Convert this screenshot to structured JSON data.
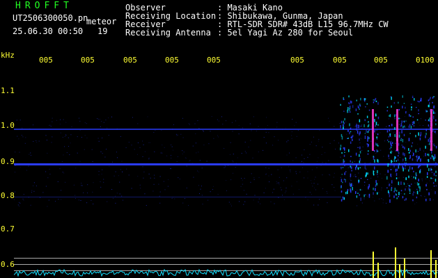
{
  "app": {
    "title": "HROFFT"
  },
  "file": {
    "name": "UT2506300050.pn",
    "meteor_label": "meteor",
    "datetime": "25.06.30 00:50",
    "meteor_count": "19"
  },
  "header": {
    "rows": [
      {
        "key": "Observer",
        "value": ": Masaki Kano"
      },
      {
        "key": "Receiving Location",
        "value": ": Shibukawa, Gunma, Japan"
      },
      {
        "key": "Receiver",
        "value": ": RTL-SDR SDR# 43dB L15 96.7MHz CW"
      },
      {
        "key": "Receiving Antenna",
        "value": ": 5el Yagi Az 280 for Seoul"
      }
    ]
  },
  "axis": {
    "unit_label": "kHz",
    "time_labels": [
      "005",
      "005",
      "005",
      "005",
      "005",
      "005",
      "005",
      "005",
      "0100"
    ],
    "freq_labels": [
      "1.1",
      "1.0",
      "0.9",
      "0.8",
      "0.7",
      "0.6"
    ]
  },
  "colors": {
    "background": "#000000",
    "title": "#22ff22",
    "axis_text": "#ffff33",
    "signal_blue": "#2a3cff",
    "signal_cyan": "#00e5ff",
    "signal_magenta": "#ff3bd6",
    "power_trace_cyan": "#16e0ff",
    "power_trace_yellow": "#ffff33"
  }
}
